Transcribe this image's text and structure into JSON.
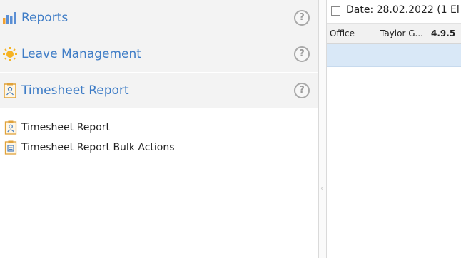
{
  "left_panel": {
    "sections": [
      {
        "title": "Reports",
        "icon": "bar-chart-icon"
      },
      {
        "title": "Leave Management",
        "icon": "sun-icon"
      },
      {
        "title": "Timesheet Report",
        "icon": "timesheet-report-icon"
      }
    ],
    "help_symbol": "?",
    "sub_items": [
      {
        "label": "Timesheet Report",
        "icon": "timesheet-report-icon"
      },
      {
        "label": "Timesheet Report Bulk Actions",
        "icon": "timesheet-bulk-icon"
      }
    ]
  },
  "right_panel": {
    "group_header": "Date: 28.02.2022 (1 El",
    "row": {
      "office": "Office",
      "user": "Taylor G...",
      "version": "4.9.5"
    }
  },
  "colors": {
    "accent": "#3e7cc6",
    "header_bg": "#f3f3f3",
    "selected_row": "#d9e8f7"
  }
}
